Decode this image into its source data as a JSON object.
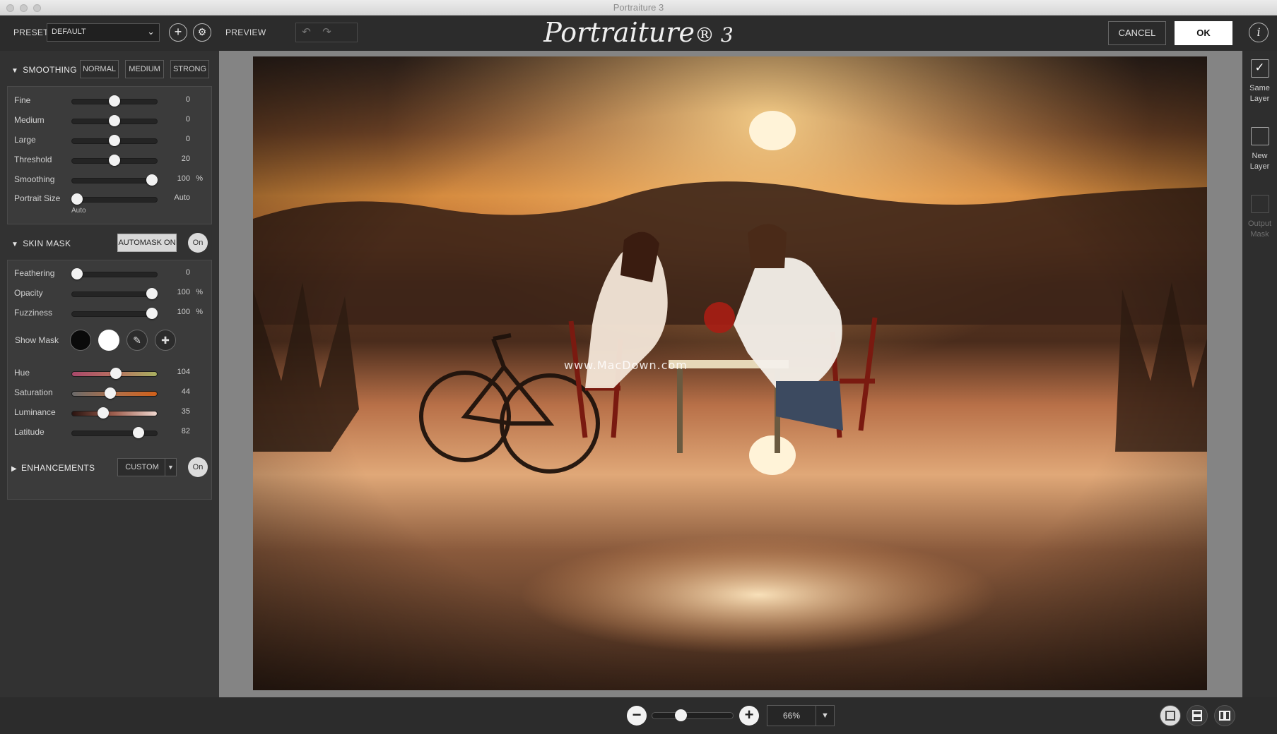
{
  "window": {
    "title": "Portraiture 3"
  },
  "toolbar": {
    "preset_label": "PRESET",
    "preset_value": "DEFAULT",
    "add_icon": "plus-icon",
    "settings_icon": "gear-icon",
    "preview_label": "PREVIEW",
    "logo_main": "Portraiture",
    "logo_rest": "® 3",
    "cancel_label": "CANCEL",
    "ok_label": "OK",
    "info_label": "i"
  },
  "smoothing": {
    "title": "SMOOTHING",
    "modes": [
      "NORMAL",
      "MEDIUM",
      "STRONG"
    ],
    "sliders": [
      {
        "label": "Fine",
        "value": "0",
        "unit": "",
        "level": 0.5
      },
      {
        "label": "Medium",
        "value": "0",
        "unit": "",
        "level": 0.5
      },
      {
        "label": "Large",
        "value": "0",
        "unit": "",
        "level": 0.5
      },
      {
        "label": "Threshold",
        "value": "20",
        "unit": "",
        "level": 0.5
      },
      {
        "label": "Smoothing",
        "value": "100",
        "unit": "%",
        "level": 1.0
      },
      {
        "label": "Portrait Size",
        "value": "Auto",
        "unit": "",
        "level": 0.0
      }
    ],
    "portrait_size_sub": "Auto"
  },
  "skin_mask": {
    "title": "SKIN MASK",
    "automask_label": "AUTOMASK ON",
    "toggle_label": "On",
    "sliders": [
      {
        "label": "Feathering",
        "value": "0",
        "unit": "",
        "level": 0.0
      },
      {
        "label": "Opacity",
        "value": "100",
        "unit": "%",
        "level": 1.0
      },
      {
        "label": "Fuzziness",
        "value": "100",
        "unit": "%",
        "level": 1.0
      }
    ],
    "show_mask_label": "Show Mask",
    "color_sliders": [
      {
        "label": "Hue",
        "value": "104",
        "level": 0.52
      },
      {
        "label": "Saturation",
        "value": "44",
        "level": 0.44
      },
      {
        "label": "Luminance",
        "value": "35",
        "level": 0.35
      },
      {
        "label": "Latitude",
        "value": "82",
        "level": 0.82
      }
    ]
  },
  "enhancements": {
    "title": "ENHANCEMENTS",
    "mode_value": "CUSTOM",
    "toggle_label": "On"
  },
  "preview": {
    "watermark": "www.MacDown.com"
  },
  "output": {
    "same_layer": "Same Layer",
    "new_layer": "New Layer",
    "output_mask": "Output Mask",
    "check_glyph": "✓"
  },
  "zoom": {
    "value": "66%",
    "level": 0.3
  },
  "colors": {
    "panel": "#323232",
    "preview_bg": "#848484",
    "accent": "#ffffff"
  }
}
